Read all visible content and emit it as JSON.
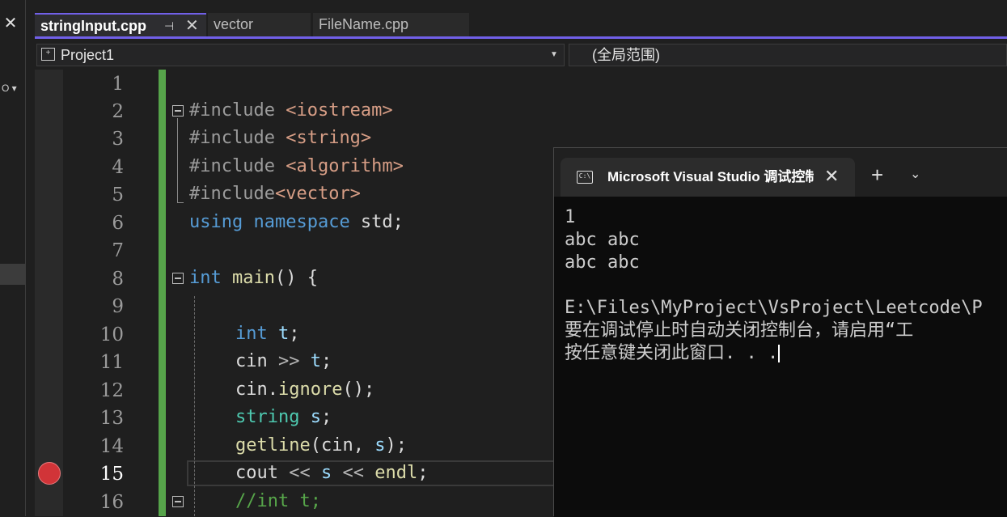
{
  "left_panel": {
    "close_glyph": "✕",
    "dropdown_label": "O ▾"
  },
  "tabs": {
    "active": {
      "label": "stringInput.cpp",
      "pin_glyph": "⊣",
      "close_glyph": "✕"
    },
    "others": [
      "vector",
      "FileName.cpp"
    ]
  },
  "navbar": {
    "project": "Project1",
    "project_arrow": "▼",
    "scope": "(全局范围)",
    "project_icon": "+"
  },
  "editor": {
    "line_numbers": [
      "1",
      "2",
      "3",
      "4",
      "5",
      "6",
      "7",
      "8",
      "9",
      "10",
      "11",
      "12",
      "13",
      "14",
      "15",
      "16"
    ],
    "current_line": "15",
    "breakpoint_line": "15",
    "lines": {
      "l2": {
        "a": "#include",
        "b": " <iostream>"
      },
      "l3": {
        "a": "#include",
        "b": " <string>"
      },
      "l4": {
        "a": "#include",
        "b": " <algorithm>"
      },
      "l5": {
        "a": "#include",
        "b": "<vector>"
      },
      "l6": {
        "a": "using",
        "b": " namespace",
        "c": " std;"
      },
      "l8": {
        "a": "int",
        "b": " main",
        "c": "() {"
      },
      "l10": {
        "a": "int",
        "b": " t",
        "c": ";"
      },
      "l11": {
        "a": "cin",
        "b": " >> ",
        "c": "t",
        "d": ";"
      },
      "l12": {
        "a": "cin.",
        "b": "ignore",
        "c": "();"
      },
      "l13": {
        "a": "string",
        "b": " s",
        "c": ";"
      },
      "l14": {
        "a": "getline",
        "b": "(cin, ",
        "c": "s",
        "d": ");"
      },
      "l15": {
        "a": "cout",
        "b": " << ",
        "c": "s",
        "d": " << ",
        "e": "endl",
        "f": ";"
      },
      "l16": {
        "a": "//int t;"
      }
    }
  },
  "console": {
    "title": "Microsoft Visual Studio 调试控制台",
    "icon_text": "C:\\",
    "close_glyph": "✕",
    "plus_glyph": "+",
    "chevron_glyph": "⌄",
    "output": [
      "1",
      "abc abc",
      "abc abc",
      "",
      "E:\\Files\\MyProject\\VsProject\\Leetcode\\P",
      "要在调试停止时自动关闭控制台，请启用“工",
      "按任意键关闭此窗口. . ."
    ]
  },
  "colors": {
    "accent": "#7160e8",
    "change_bar": "#56a44a",
    "breakpoint": "#d13438",
    "keyword": "#569cd6",
    "string_include": "#d69d85",
    "comment": "#57a64a"
  }
}
